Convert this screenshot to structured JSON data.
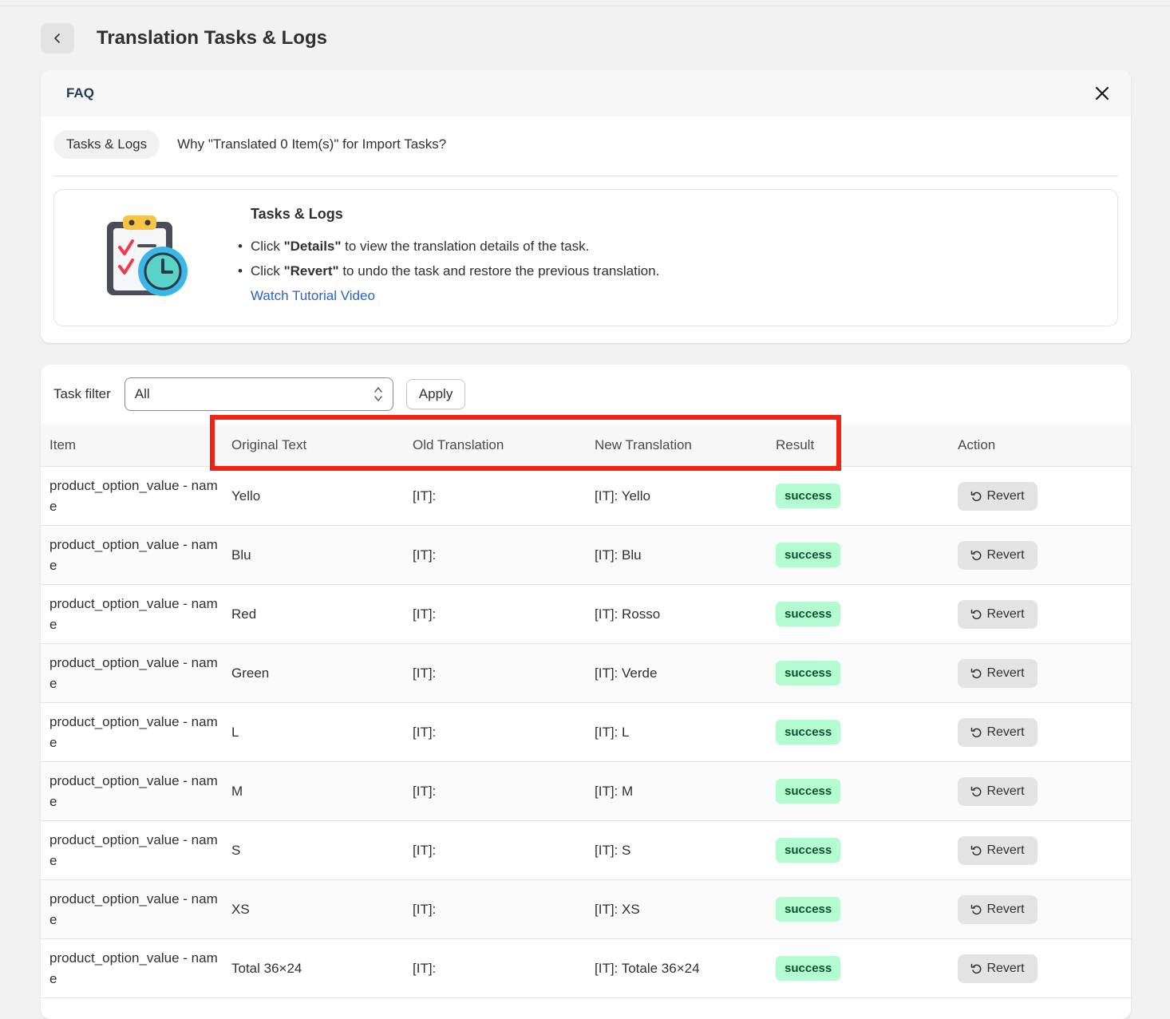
{
  "header": {
    "title": "Translation Tasks & Logs"
  },
  "faq": {
    "title": "FAQ",
    "tabs": [
      "Tasks & Logs",
      "Why \"Translated 0 Item(s)\" for Import Tasks?"
    ],
    "panel": {
      "title": "Tasks & Logs",
      "bullets": [
        {
          "pre": "Click ",
          "bold": "\"Details\"",
          "post": " to view the translation details of the task."
        },
        {
          "pre": "Click ",
          "bold": "\"Revert\"",
          "post": " to undo the task and restore the previous translation."
        }
      ],
      "link": "Watch Tutorial Video"
    }
  },
  "filter": {
    "label": "Task filter",
    "value": "All",
    "apply": "Apply"
  },
  "table": {
    "columns": [
      "Item",
      "Original Text",
      "Old Translation",
      "New Translation",
      "Result",
      "Action"
    ],
    "rows": [
      {
        "item": "product_option_value - name",
        "original": "Yello",
        "old": "[IT]:",
        "new": "[IT]: Yello",
        "result": "success",
        "action": "Revert"
      },
      {
        "item": "product_option_value - name",
        "original": "Blu",
        "old": "[IT]:",
        "new": "[IT]: Blu",
        "result": "success",
        "action": "Revert"
      },
      {
        "item": "product_option_value - name",
        "original": "Red",
        "old": "[IT]:",
        "new": "[IT]: Rosso",
        "result": "success",
        "action": "Revert"
      },
      {
        "item": "product_option_value - name",
        "original": "Green",
        "old": "[IT]:",
        "new": "[IT]: Verde",
        "result": "success",
        "action": "Revert"
      },
      {
        "item": "product_option_value - name",
        "original": "L",
        "old": "[IT]:",
        "new": "[IT]: L",
        "result": "success",
        "action": "Revert"
      },
      {
        "item": "product_option_value - name",
        "original": "M",
        "old": "[IT]:",
        "new": "[IT]: M",
        "result": "success",
        "action": "Revert"
      },
      {
        "item": "product_option_value - name",
        "original": "S",
        "old": "[IT]:",
        "new": "[IT]: S",
        "result": "success",
        "action": "Revert"
      },
      {
        "item": "product_option_value - name",
        "original": "XS",
        "old": "[IT]:",
        "new": "[IT]: XS",
        "result": "success",
        "action": "Revert"
      },
      {
        "item": "product_option_value - name",
        "original": "Total 36×24",
        "old": "[IT]:",
        "new": "[IT]: Totale 36×24",
        "result": "success",
        "action": "Revert"
      }
    ]
  },
  "colors": {
    "accent_link": "#2563d8",
    "success_bg": "#b4fcd0",
    "success_fg": "#0c5132",
    "highlight": "#f02415"
  },
  "icons": {
    "back": "chevron-left-icon",
    "close": "close-icon",
    "select": "select-chevrons-icon",
    "revert": "undo-icon",
    "illustration": "clipboard-clock-icon"
  }
}
